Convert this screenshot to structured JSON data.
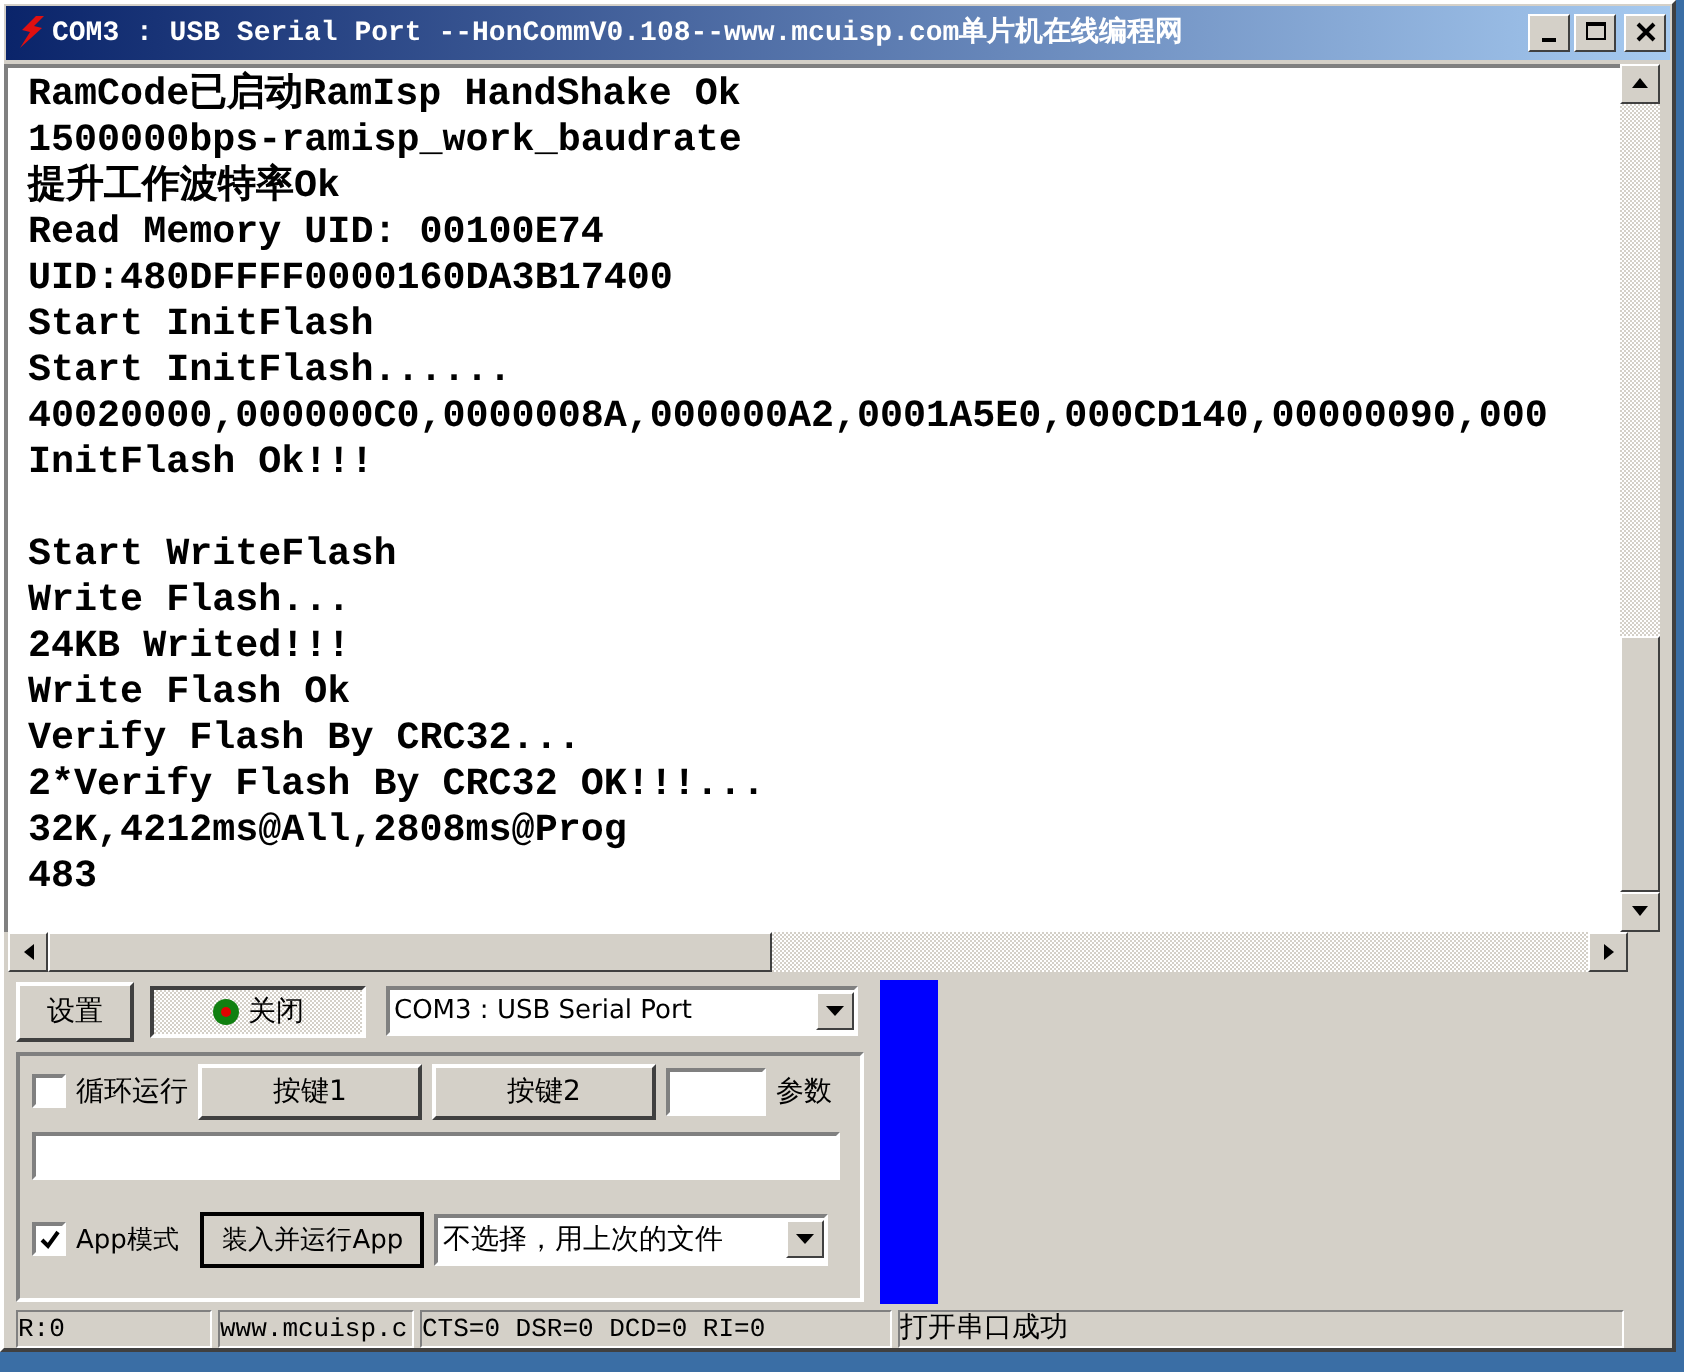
{
  "window": {
    "title": "COM3 : USB Serial Port  --HonCommV0.108--www.mcuisp.com单片机在线编程网"
  },
  "output": {
    "blocks": [
      [
        "RamCode已启动RamIsp HandShake Ok",
        "1500000bps-ramisp_work_baudrate",
        "提升工作波特率Ok",
        "Read Memory UID: 00100E74",
        "UID:480DFFFF0000160DA3B17400",
        "Start InitFlash",
        "Start InitFlash......",
        "40020000,000000C0,0000008A,000000A2,0001A5E0,000CD140,00000090,000",
        "InitFlash Ok!!!"
      ],
      [
        "Start WriteFlash",
        "Write Flash...",
        "24KB Writed!!!",
        "Write Flash Ok",
        "Verify Flash By CRC32...",
        "2*Verify Flash By CRC32 OK!!!...",
        "32K,4212ms@All,2808ms@Prog",
        "483"
      ]
    ]
  },
  "controls": {
    "settings_button": "设置",
    "port_button": {
      "label": "关闭",
      "pressed": true
    },
    "port_select": {
      "value": "COM3 : USB Serial Port"
    },
    "loop_run": {
      "label": "循环运行",
      "checked": false
    },
    "key_buttons": [
      "按键1",
      "按键2"
    ],
    "param_label": "参数",
    "app_mode": {
      "label": "App模式",
      "checked": true
    },
    "load_run_button": "装入并运行App",
    "file_select": {
      "value": "不选择，用上次的文件"
    }
  },
  "progress": {
    "level": 1
  },
  "status_bar": [
    "R:0",
    "www.mcuisp.c",
    "CTS=0 DSR=0 DCD=0 RI=0",
    "打开串口成功"
  ]
}
